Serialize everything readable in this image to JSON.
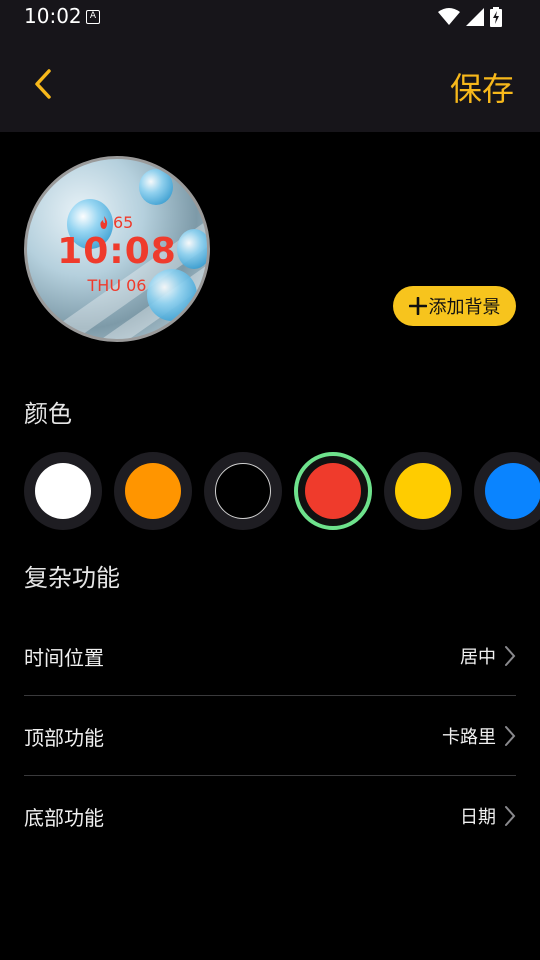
{
  "status": {
    "time": "10:02",
    "a_icon": "A"
  },
  "appbar": {
    "back_icon": "chevron-left-icon",
    "save_label": "保存",
    "accent": "#f7b81b"
  },
  "watch_preview": {
    "steps": "65",
    "time": "10:08",
    "date": "THU 06",
    "text_color": "#ef3b2c"
  },
  "add_background_label": "添加背景",
  "color_section": {
    "title": "颜色",
    "swatches": [
      {
        "name": "white",
        "color": "#ffffff",
        "selected": false
      },
      {
        "name": "orange",
        "color": "#ff9500",
        "selected": false
      },
      {
        "name": "black",
        "color": "#000000",
        "selected": false
      },
      {
        "name": "red",
        "color": "#ef3b2c",
        "selected": true
      },
      {
        "name": "yellow",
        "color": "#ffcc00",
        "selected": false
      },
      {
        "name": "blue",
        "color": "#0a84ff",
        "selected": false
      }
    ]
  },
  "complications": {
    "title": "复杂功能",
    "rows": [
      {
        "label": "时间位置",
        "value": "居中"
      },
      {
        "label": "顶部功能",
        "value": "卡路里"
      },
      {
        "label": "底部功能",
        "value": "日期"
      }
    ]
  }
}
